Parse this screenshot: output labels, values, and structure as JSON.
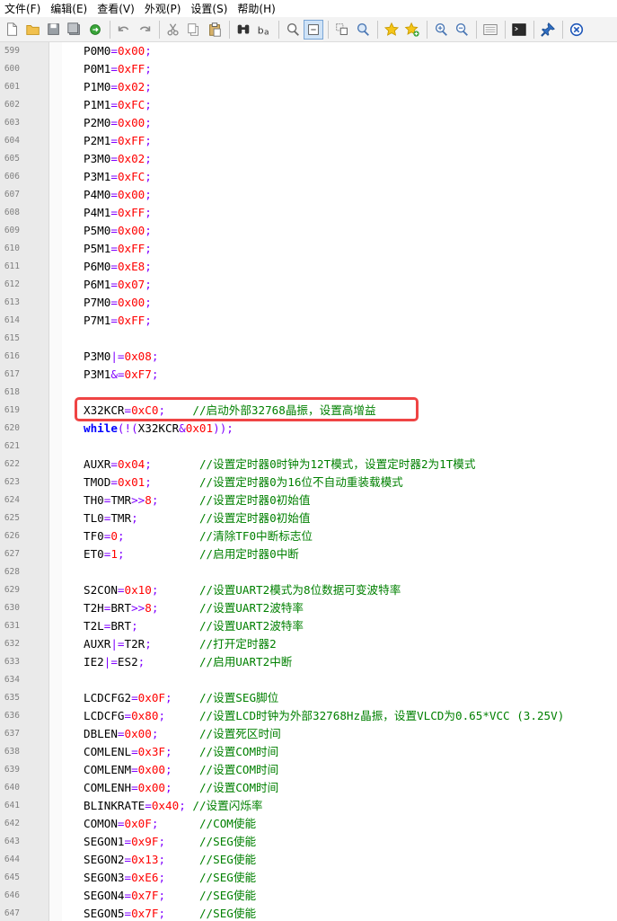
{
  "menu": [
    "文件(F)",
    "编辑(E)",
    "查看(V)",
    "外观(P)",
    "设置(S)",
    "帮助(H)"
  ],
  "toolbar": [
    {
      "icon": "new-file-icon"
    },
    {
      "icon": "open-folder-icon"
    },
    {
      "icon": "save-icon"
    },
    {
      "icon": "save-all-icon"
    },
    {
      "icon": "reload-icon"
    },
    {
      "sep": true
    },
    {
      "icon": "undo-icon"
    },
    {
      "icon": "redo-icon"
    },
    {
      "sep": true
    },
    {
      "icon": "cut-icon"
    },
    {
      "icon": "copy-icon"
    },
    {
      "icon": "paste-icon"
    },
    {
      "sep": true
    },
    {
      "icon": "find-icon"
    },
    {
      "icon": "replace-icon"
    },
    {
      "sep": true
    },
    {
      "icon": "find-in-files-icon"
    },
    {
      "icon": "word-wrap-icon",
      "active": true
    },
    {
      "sep": true
    },
    {
      "icon": "select-block-icon"
    },
    {
      "icon": "zoom-find-icon"
    },
    {
      "sep": true
    },
    {
      "icon": "bookmark-star-icon"
    },
    {
      "icon": "bookmark-add-icon"
    },
    {
      "sep": true
    },
    {
      "icon": "zoom-in-icon"
    },
    {
      "icon": "zoom-out-icon"
    },
    {
      "sep": true
    },
    {
      "icon": "scheme-icon"
    },
    {
      "sep": true
    },
    {
      "icon": "console-icon"
    },
    {
      "sep": true
    },
    {
      "icon": "pin-icon"
    },
    {
      "sep": true
    },
    {
      "icon": "close-circle-icon"
    }
  ],
  "colors": {
    "number": "#ff0000",
    "operator": "#8000ff",
    "keyword": "#0000ff",
    "comment": "#008000",
    "highlight": "#ef4444"
  },
  "lines": [
    {
      "n": "599",
      "t": [
        [
          "id",
          "P0M0"
        ],
        [
          "op",
          "="
        ],
        [
          "num",
          "0x00"
        ],
        [
          "op",
          ";"
        ]
      ]
    },
    {
      "n": "600",
      "t": [
        [
          "id",
          "P0M1"
        ],
        [
          "op",
          "="
        ],
        [
          "num",
          "0xFF"
        ],
        [
          "op",
          ";"
        ]
      ]
    },
    {
      "n": "601",
      "t": [
        [
          "id",
          "P1M0"
        ],
        [
          "op",
          "="
        ],
        [
          "num",
          "0x02"
        ],
        [
          "op",
          ";"
        ]
      ]
    },
    {
      "n": "602",
      "t": [
        [
          "id",
          "P1M1"
        ],
        [
          "op",
          "="
        ],
        [
          "num",
          "0xFC"
        ],
        [
          "op",
          ";"
        ]
      ]
    },
    {
      "n": "603",
      "t": [
        [
          "id",
          "P2M0"
        ],
        [
          "op",
          "="
        ],
        [
          "num",
          "0x00"
        ],
        [
          "op",
          ";"
        ]
      ]
    },
    {
      "n": "604",
      "t": [
        [
          "id",
          "P2M1"
        ],
        [
          "op",
          "="
        ],
        [
          "num",
          "0xFF"
        ],
        [
          "op",
          ";"
        ]
      ]
    },
    {
      "n": "605",
      "t": [
        [
          "id",
          "P3M0"
        ],
        [
          "op",
          "="
        ],
        [
          "num",
          "0x02"
        ],
        [
          "op",
          ";"
        ]
      ]
    },
    {
      "n": "606",
      "t": [
        [
          "id",
          "P3M1"
        ],
        [
          "op",
          "="
        ],
        [
          "num",
          "0xFC"
        ],
        [
          "op",
          ";"
        ]
      ]
    },
    {
      "n": "607",
      "t": [
        [
          "id",
          "P4M0"
        ],
        [
          "op",
          "="
        ],
        [
          "num",
          "0x00"
        ],
        [
          "op",
          ";"
        ]
      ]
    },
    {
      "n": "608",
      "t": [
        [
          "id",
          "P4M1"
        ],
        [
          "op",
          "="
        ],
        [
          "num",
          "0xFF"
        ],
        [
          "op",
          ";"
        ]
      ]
    },
    {
      "n": "609",
      "t": [
        [
          "id",
          "P5M0"
        ],
        [
          "op",
          "="
        ],
        [
          "num",
          "0x00"
        ],
        [
          "op",
          ";"
        ]
      ]
    },
    {
      "n": "610",
      "t": [
        [
          "id",
          "P5M1"
        ],
        [
          "op",
          "="
        ],
        [
          "num",
          "0xFF"
        ],
        [
          "op",
          ";"
        ]
      ]
    },
    {
      "n": "611",
      "t": [
        [
          "id",
          "P6M0"
        ],
        [
          "op",
          "="
        ],
        [
          "num",
          "0xE8"
        ],
        [
          "op",
          ";"
        ]
      ]
    },
    {
      "n": "612",
      "t": [
        [
          "id",
          "P6M1"
        ],
        [
          "op",
          "="
        ],
        [
          "num",
          "0x07"
        ],
        [
          "op",
          ";"
        ]
      ]
    },
    {
      "n": "613",
      "t": [
        [
          "id",
          "P7M0"
        ],
        [
          "op",
          "="
        ],
        [
          "num",
          "0x00"
        ],
        [
          "op",
          ";"
        ]
      ]
    },
    {
      "n": "614",
      "t": [
        [
          "id",
          "P7M1"
        ],
        [
          "op",
          "="
        ],
        [
          "num",
          "0xFF"
        ],
        [
          "op",
          ";"
        ]
      ]
    },
    {
      "n": "615",
      "t": []
    },
    {
      "n": "616",
      "t": [
        [
          "id",
          "P3M0"
        ],
        [
          "op",
          "|="
        ],
        [
          "num",
          "0x08"
        ],
        [
          "op",
          ";"
        ]
      ]
    },
    {
      "n": "617",
      "t": [
        [
          "id",
          "P3M1"
        ],
        [
          "op",
          "&="
        ],
        [
          "num",
          "0xF7"
        ],
        [
          "op",
          ";"
        ]
      ]
    },
    {
      "n": "618",
      "t": []
    },
    {
      "n": "619",
      "t": [
        [
          "id",
          "X32KCR"
        ],
        [
          "op",
          "="
        ],
        [
          "num",
          "0xC0"
        ],
        [
          "op",
          ";"
        ],
        [
          "tx",
          "    "
        ],
        [
          "cm",
          "//启动外部32768晶振，设置高增益"
        ]
      ]
    },
    {
      "n": "620",
      "t": [
        [
          "kw",
          "while"
        ],
        [
          "op",
          "(!("
        ],
        [
          "id",
          "X32KCR"
        ],
        [
          "op",
          "&"
        ],
        [
          "num",
          "0x01"
        ],
        [
          "op",
          "));"
        ]
      ]
    },
    {
      "n": "621",
      "t": []
    },
    {
      "n": "622",
      "t": [
        [
          "id",
          "AUXR"
        ],
        [
          "op",
          "="
        ],
        [
          "num",
          "0x04"
        ],
        [
          "op",
          ";"
        ],
        [
          "tx",
          "       "
        ],
        [
          "cm",
          "//设置定时器0时钟为12T模式，设置定时器2为1T模式"
        ]
      ]
    },
    {
      "n": "623",
      "t": [
        [
          "id",
          "TMOD"
        ],
        [
          "op",
          "="
        ],
        [
          "num",
          "0x01"
        ],
        [
          "op",
          ";"
        ],
        [
          "tx",
          "       "
        ],
        [
          "cm",
          "//设置定时器0为16位不自动重装载模式"
        ]
      ]
    },
    {
      "n": "624",
      "t": [
        [
          "id",
          "TH0"
        ],
        [
          "op",
          "="
        ],
        [
          "id",
          "TMR"
        ],
        [
          "op",
          ">>"
        ],
        [
          "num",
          "8"
        ],
        [
          "op",
          ";"
        ],
        [
          "tx",
          "      "
        ],
        [
          "cm",
          "//设置定时器0初始值"
        ]
      ]
    },
    {
      "n": "625",
      "t": [
        [
          "id",
          "TL0"
        ],
        [
          "op",
          "="
        ],
        [
          "id",
          "TMR"
        ],
        [
          "op",
          ";"
        ],
        [
          "tx",
          "         "
        ],
        [
          "cm",
          "//设置定时器0初始值"
        ]
      ]
    },
    {
      "n": "626",
      "t": [
        [
          "id",
          "TF0"
        ],
        [
          "op",
          "="
        ],
        [
          "num",
          "0"
        ],
        [
          "op",
          ";"
        ],
        [
          "tx",
          "           "
        ],
        [
          "cm",
          "//清除TF0中断标志位"
        ]
      ]
    },
    {
      "n": "627",
      "t": [
        [
          "id",
          "ET0"
        ],
        [
          "op",
          "="
        ],
        [
          "num",
          "1"
        ],
        [
          "op",
          ";"
        ],
        [
          "tx",
          "           "
        ],
        [
          "cm",
          "//启用定时器0中断"
        ]
      ]
    },
    {
      "n": "628",
      "t": []
    },
    {
      "n": "629",
      "t": [
        [
          "id",
          "S2CON"
        ],
        [
          "op",
          "="
        ],
        [
          "num",
          "0x10"
        ],
        [
          "op",
          ";"
        ],
        [
          "tx",
          "      "
        ],
        [
          "cm",
          "//设置UART2模式为8位数据可变波特率"
        ]
      ]
    },
    {
      "n": "630",
      "t": [
        [
          "id",
          "T2H"
        ],
        [
          "op",
          "="
        ],
        [
          "id",
          "BRT"
        ],
        [
          "op",
          ">>"
        ],
        [
          "num",
          "8"
        ],
        [
          "op",
          ";"
        ],
        [
          "tx",
          "      "
        ],
        [
          "cm",
          "//设置UART2波特率"
        ]
      ]
    },
    {
      "n": "631",
      "t": [
        [
          "id",
          "T2L"
        ],
        [
          "op",
          "="
        ],
        [
          "id",
          "BRT"
        ],
        [
          "op",
          ";"
        ],
        [
          "tx",
          "         "
        ],
        [
          "cm",
          "//设置UART2波特率"
        ]
      ]
    },
    {
      "n": "632",
      "t": [
        [
          "id",
          "AUXR"
        ],
        [
          "op",
          "|="
        ],
        [
          "id",
          "T2R"
        ],
        [
          "op",
          ";"
        ],
        [
          "tx",
          "       "
        ],
        [
          "cm",
          "//打开定时器2"
        ]
      ]
    },
    {
      "n": "633",
      "t": [
        [
          "id",
          "IE2"
        ],
        [
          "op",
          "|="
        ],
        [
          "id",
          "ES2"
        ],
        [
          "op",
          ";"
        ],
        [
          "tx",
          "        "
        ],
        [
          "cm",
          "//启用UART2中断"
        ]
      ]
    },
    {
      "n": "634",
      "t": []
    },
    {
      "n": "635",
      "t": [
        [
          "id",
          "LCDCFG2"
        ],
        [
          "op",
          "="
        ],
        [
          "num",
          "0x0F"
        ],
        [
          "op",
          ";"
        ],
        [
          "tx",
          "    "
        ],
        [
          "cm",
          "//设置SEG脚位"
        ]
      ]
    },
    {
      "n": "636",
      "t": [
        [
          "id",
          "LCDCFG"
        ],
        [
          "op",
          "="
        ],
        [
          "num",
          "0x80"
        ],
        [
          "op",
          ";"
        ],
        [
          "tx",
          "     "
        ],
        [
          "cm",
          "//设置LCD时钟为外部32768Hz晶振，设置VLCD为0.65*VCC (3.25V)"
        ]
      ]
    },
    {
      "n": "637",
      "t": [
        [
          "id",
          "DBLEN"
        ],
        [
          "op",
          "="
        ],
        [
          "num",
          "0x00"
        ],
        [
          "op",
          ";"
        ],
        [
          "tx",
          "      "
        ],
        [
          "cm",
          "//设置死区时间"
        ]
      ]
    },
    {
      "n": "638",
      "t": [
        [
          "id",
          "COMLENL"
        ],
        [
          "op",
          "="
        ],
        [
          "num",
          "0x3F"
        ],
        [
          "op",
          ";"
        ],
        [
          "tx",
          "    "
        ],
        [
          "cm",
          "//设置COM时间"
        ]
      ]
    },
    {
      "n": "639",
      "t": [
        [
          "id",
          "COMLENM"
        ],
        [
          "op",
          "="
        ],
        [
          "num",
          "0x00"
        ],
        [
          "op",
          ";"
        ],
        [
          "tx",
          "    "
        ],
        [
          "cm",
          "//设置COM时间"
        ]
      ]
    },
    {
      "n": "640",
      "t": [
        [
          "id",
          "COMLENH"
        ],
        [
          "op",
          "="
        ],
        [
          "num",
          "0x00"
        ],
        [
          "op",
          ";"
        ],
        [
          "tx",
          "    "
        ],
        [
          "cm",
          "//设置COM时间"
        ]
      ]
    },
    {
      "n": "641",
      "t": [
        [
          "id",
          "BLINKRATE"
        ],
        [
          "op",
          "="
        ],
        [
          "num",
          "0x40"
        ],
        [
          "op",
          ";"
        ],
        [
          "tx",
          " "
        ],
        [
          "cm",
          "//设置闪烁率"
        ]
      ]
    },
    {
      "n": "642",
      "t": [
        [
          "id",
          "COMON"
        ],
        [
          "op",
          "="
        ],
        [
          "num",
          "0x0F"
        ],
        [
          "op",
          ";"
        ],
        [
          "tx",
          "      "
        ],
        [
          "cm",
          "//COM使能"
        ]
      ]
    },
    {
      "n": "643",
      "t": [
        [
          "id",
          "SEGON1"
        ],
        [
          "op",
          "="
        ],
        [
          "num",
          "0x9F"
        ],
        [
          "op",
          ";"
        ],
        [
          "tx",
          "     "
        ],
        [
          "cm",
          "//SEG使能"
        ]
      ]
    },
    {
      "n": "644",
      "t": [
        [
          "id",
          "SEGON2"
        ],
        [
          "op",
          "="
        ],
        [
          "num",
          "0x13"
        ],
        [
          "op",
          ";"
        ],
        [
          "tx",
          "     "
        ],
        [
          "cm",
          "//SEG使能"
        ]
      ]
    },
    {
      "n": "645",
      "t": [
        [
          "id",
          "SEGON3"
        ],
        [
          "op",
          "="
        ],
        [
          "num",
          "0xE6"
        ],
        [
          "op",
          ";"
        ],
        [
          "tx",
          "     "
        ],
        [
          "cm",
          "//SEG使能"
        ]
      ]
    },
    {
      "n": "646",
      "t": [
        [
          "id",
          "SEGON4"
        ],
        [
          "op",
          "="
        ],
        [
          "num",
          "0x7F"
        ],
        [
          "op",
          ";"
        ],
        [
          "tx",
          "     "
        ],
        [
          "cm",
          "//SEG使能"
        ]
      ]
    },
    {
      "n": "647",
      "t": [
        [
          "id",
          "SEGON5"
        ],
        [
          "op",
          "="
        ],
        [
          "num",
          "0x7F"
        ],
        [
          "op",
          ";"
        ],
        [
          "tx",
          "     "
        ],
        [
          "cm",
          "//SEG使能"
        ]
      ]
    }
  ]
}
